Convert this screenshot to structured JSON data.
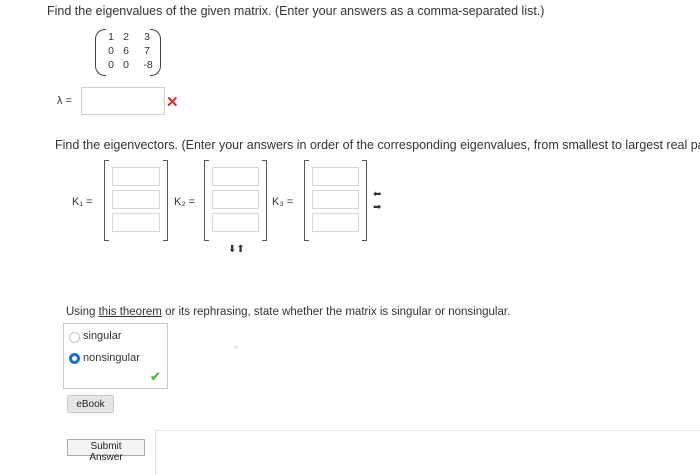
{
  "question1": {
    "text": "Find the eigenvalues of the given matrix. (Enter your answers as a comma-separated list.)"
  },
  "matrix": {
    "rows": [
      [
        "1",
        "2",
        "3"
      ],
      [
        "0",
        "6",
        "7"
      ],
      [
        "0",
        "0",
        "-8"
      ]
    ]
  },
  "eigenvalues": {
    "label": "λ =",
    "value": "",
    "status_icon": "x-mark",
    "status_glyph": "✕"
  },
  "question2": {
    "text": "Find the eigenvectors. (Enter your answers in order of the corresponding eigenvalues, from smallest to largest real part a"
  },
  "vectors": [
    {
      "label": "K₁ =",
      "entries": [
        "",
        "",
        ""
      ]
    },
    {
      "label": "K₂ =",
      "entries": [
        "",
        "",
        ""
      ]
    },
    {
      "label": "K₃ =",
      "entries": [
        "",
        "",
        ""
      ]
    }
  ],
  "side_arrows": {
    "right_top": "⬅",
    "right_bottom": "➡",
    "bottom": "⬇⬆"
  },
  "question3": {
    "prefix": "Using ",
    "link": "this theorem",
    "middle": " or its rephrasing",
    "suffix": ", state whether the matrix is singular or nonsingular."
  },
  "options": [
    {
      "label": "singular",
      "selected": false
    },
    {
      "label": "nonsingular",
      "selected": true
    }
  ],
  "check_glyph": "✔",
  "buttons": {
    "ebook": "eBook",
    "submit": "Submit Answer"
  },
  "colors": {
    "error": "#d32f2f",
    "correct": "#5cb85c",
    "radio_selected": "#1a6fd0"
  }
}
